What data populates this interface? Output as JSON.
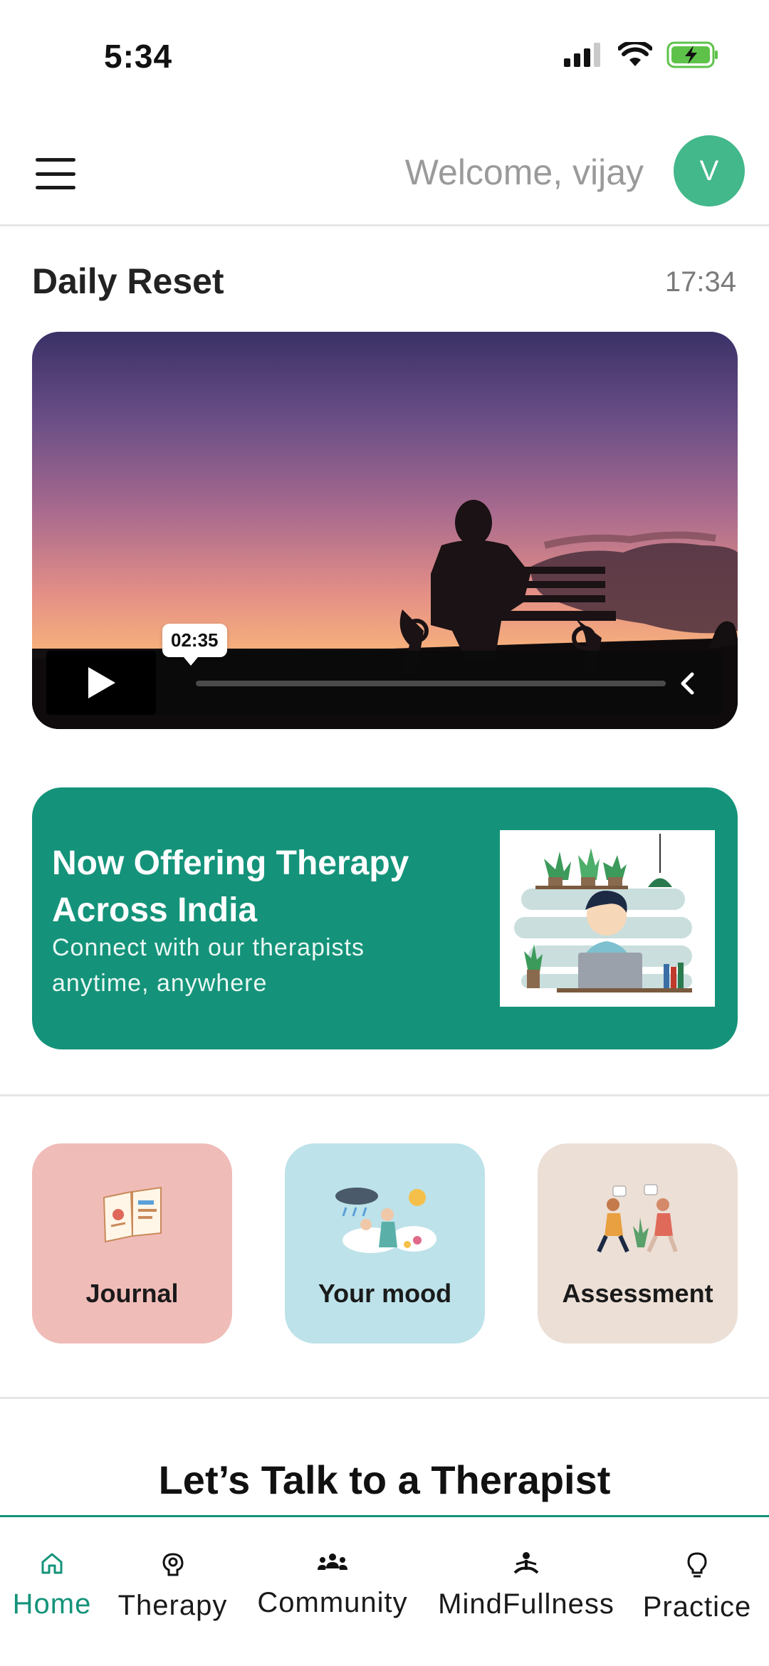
{
  "status_bar": {
    "time": "5:34"
  },
  "header": {
    "welcome": "Welcome, vijay",
    "avatar_initial": "V"
  },
  "daily_reset": {
    "title": "Daily Reset",
    "time": "17:34",
    "video_time": "02:35"
  },
  "banner": {
    "title": "Now Offering Therapy Across India",
    "subtitle": "Connect with our therapists anytime, anywhere"
  },
  "tiles": [
    {
      "label": "Journal",
      "color": "#f0bcb8"
    },
    {
      "label": "Your mood",
      "color": "#bde2ea"
    },
    {
      "label": "Assessment",
      "color": "#ecdfd6"
    }
  ],
  "talk_title": "Let’s Talk to a Therapist",
  "nav": [
    {
      "label": "Home",
      "icon": "home-icon",
      "active": true
    },
    {
      "label": "Therapy",
      "icon": "brain-icon",
      "active": false
    },
    {
      "label": "Community",
      "icon": "community-icon",
      "active": false
    },
    {
      "label": "MindFullness",
      "icon": "meditation-icon",
      "active": false
    },
    {
      "label": "Practice",
      "icon": "lightbulb-icon",
      "active": false
    }
  ],
  "colors": {
    "accent": "#14937a",
    "avatar": "#43b88a"
  }
}
